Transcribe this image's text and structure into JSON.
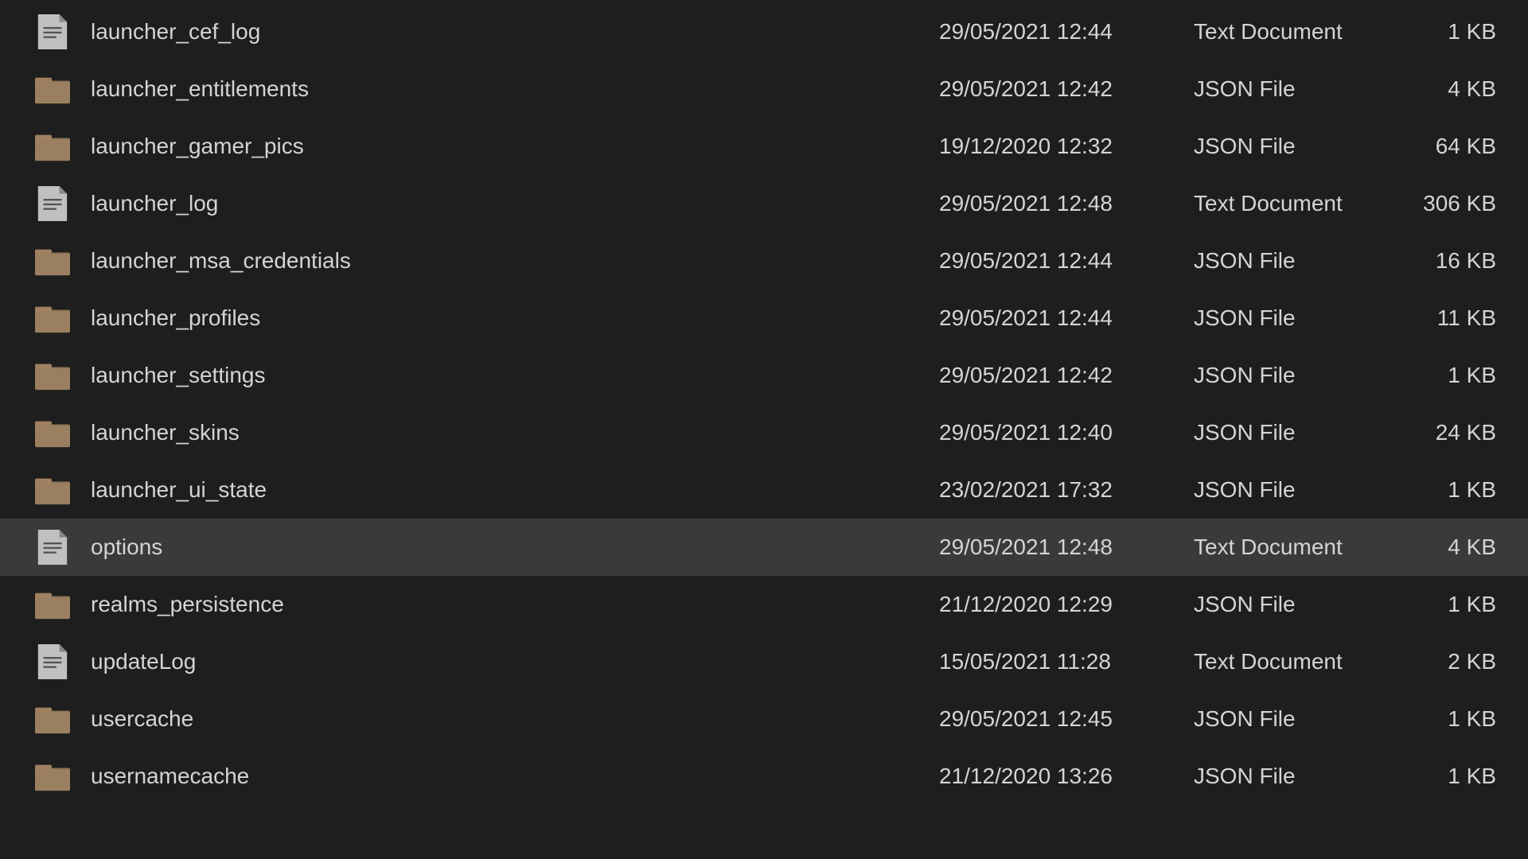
{
  "files": [
    {
      "name": "launcher_cef_log",
      "date": "29/05/2021 12:44",
      "type": "Text Document",
      "size": "1 KB",
      "iconType": "text",
      "selected": false
    },
    {
      "name": "launcher_entitlements",
      "date": "29/05/2021 12:42",
      "type": "JSON File",
      "size": "4 KB",
      "iconType": "folder",
      "selected": false
    },
    {
      "name": "launcher_gamer_pics",
      "date": "19/12/2020 12:32",
      "type": "JSON File",
      "size": "64 KB",
      "iconType": "folder",
      "selected": false
    },
    {
      "name": "launcher_log",
      "date": "29/05/2021 12:48",
      "type": "Text Document",
      "size": "306 KB",
      "iconType": "text",
      "selected": false
    },
    {
      "name": "launcher_msa_credentials",
      "date": "29/05/2021 12:44",
      "type": "JSON File",
      "size": "16 KB",
      "iconType": "folder",
      "selected": false
    },
    {
      "name": "launcher_profiles",
      "date": "29/05/2021 12:44",
      "type": "JSON File",
      "size": "11 KB",
      "iconType": "folder",
      "selected": false
    },
    {
      "name": "launcher_settings",
      "date": "29/05/2021 12:42",
      "type": "JSON File",
      "size": "1 KB",
      "iconType": "folder",
      "selected": false
    },
    {
      "name": "launcher_skins",
      "date": "29/05/2021 12:40",
      "type": "JSON File",
      "size": "24 KB",
      "iconType": "folder",
      "selected": false
    },
    {
      "name": "launcher_ui_state",
      "date": "23/02/2021 17:32",
      "type": "JSON File",
      "size": "1 KB",
      "iconType": "folder",
      "selected": false
    },
    {
      "name": "options",
      "date": "29/05/2021 12:48",
      "type": "Text Document",
      "size": "4 KB",
      "iconType": "text",
      "selected": true
    },
    {
      "name": "realms_persistence",
      "date": "21/12/2020 12:29",
      "type": "JSON File",
      "size": "1 KB",
      "iconType": "folder",
      "selected": false
    },
    {
      "name": "updateLog",
      "date": "15/05/2021 11:28",
      "type": "Text Document",
      "size": "2 KB",
      "iconType": "text",
      "selected": false
    },
    {
      "name": "usercache",
      "date": "29/05/2021 12:45",
      "type": "JSON File",
      "size": "1 KB",
      "iconType": "folder",
      "selected": false
    },
    {
      "name": "usernamecache",
      "date": "21/12/2020 13:26",
      "type": "JSON File",
      "size": "1 KB",
      "iconType": "folder",
      "selected": false
    }
  ],
  "colors": {
    "background": "#1e1e1e",
    "selected": "#3a3a3a",
    "text": "#d4d4d4",
    "folderColor": "#8b7355",
    "textIconColor": "#b0b0b0"
  }
}
